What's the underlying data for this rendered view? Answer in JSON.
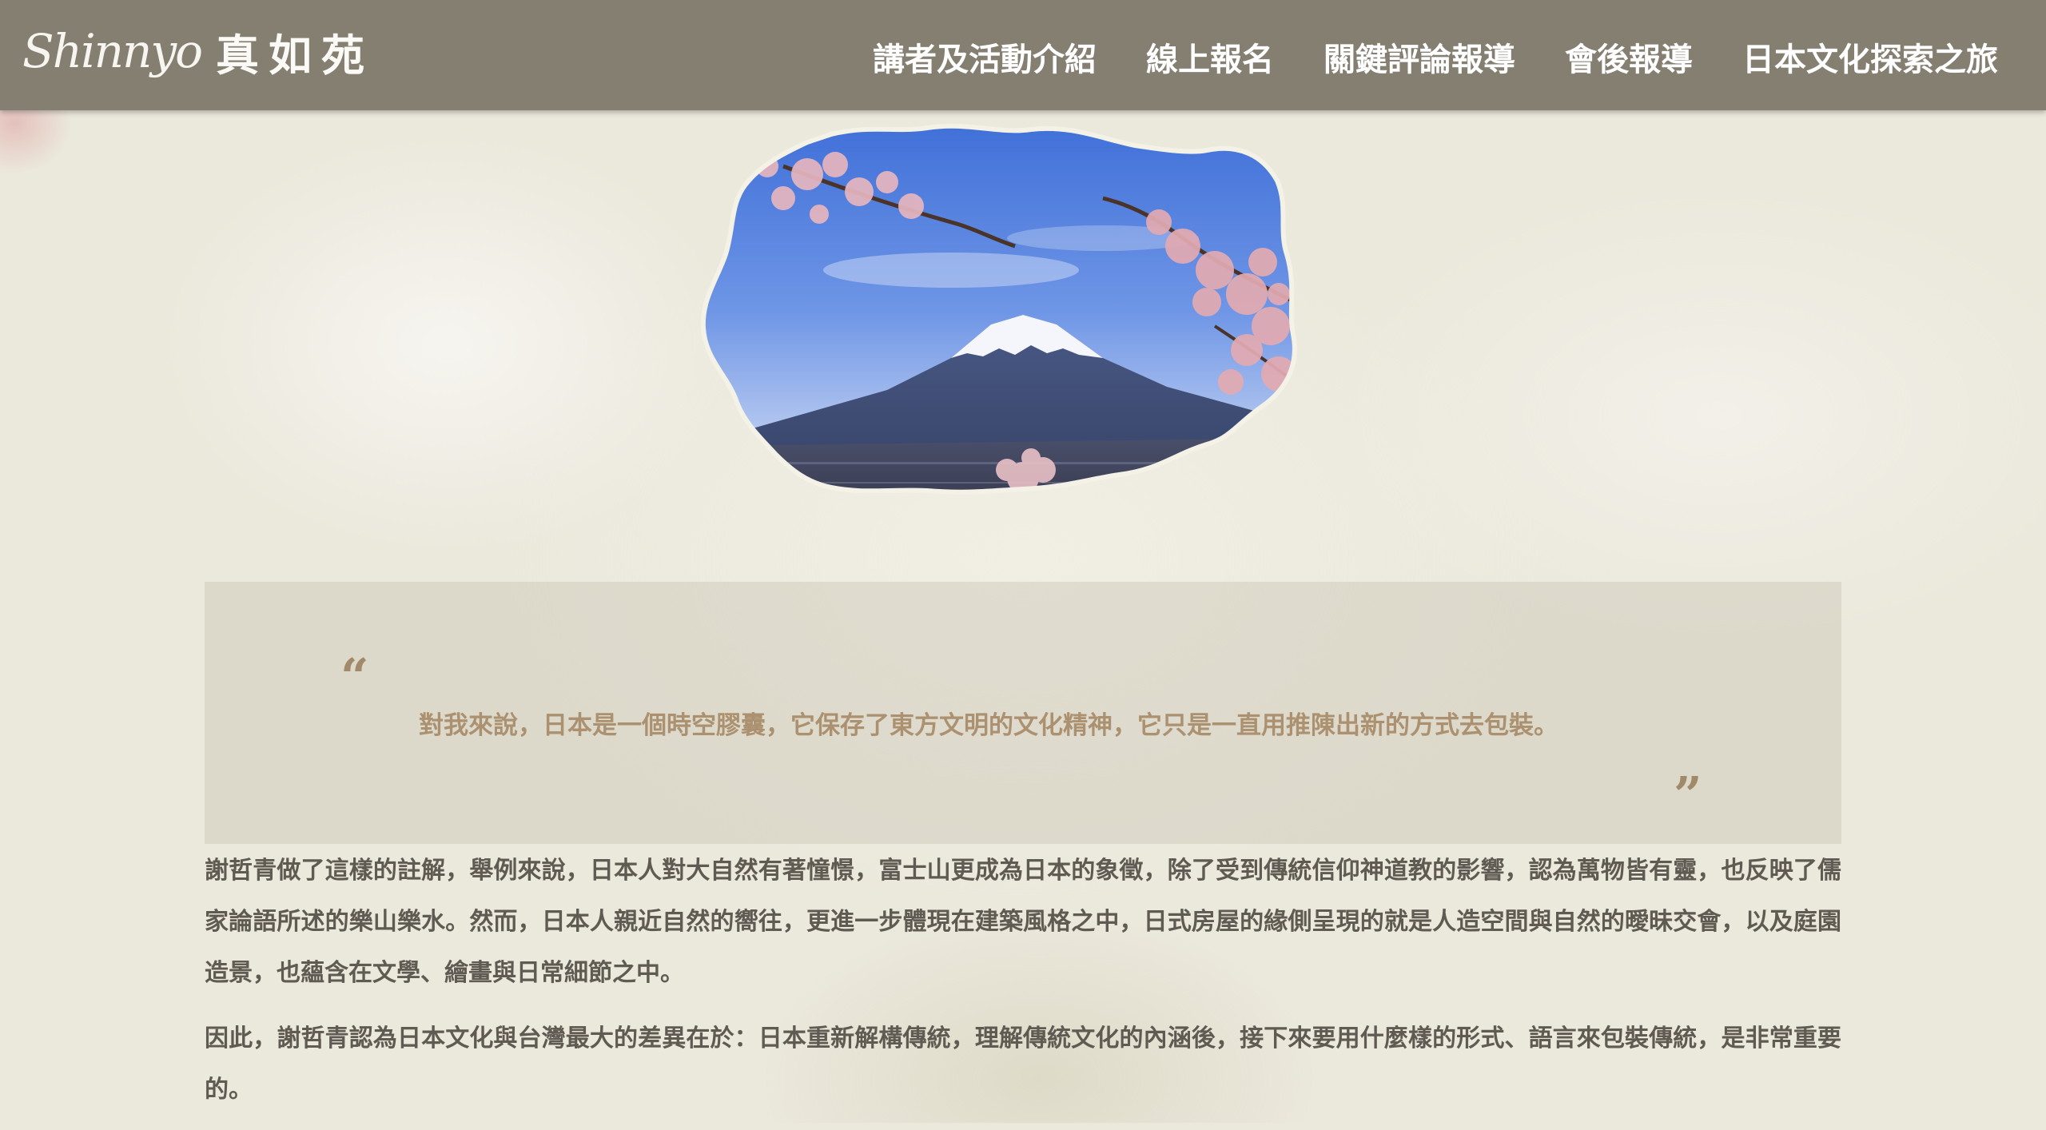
{
  "header": {
    "logo_script": "Shinnyo",
    "logo_kanji": "真如苑",
    "nav": [
      {
        "label": "講者及活動介紹"
      },
      {
        "label": "線上報名"
      },
      {
        "label": "關鍵評論報導"
      },
      {
        "label": "會後報導"
      },
      {
        "label": "日本文化探索之旅"
      }
    ]
  },
  "hero": {
    "image": "mount-fuji-cherry-blossom"
  },
  "quote": {
    "open_mark": "“",
    "text": "對我來說，日本是一個時空膠囊，它保存了東方文明的文化精神，它只是一直用推陳出新的方式去包裝。",
    "close_mark": "”"
  },
  "body": {
    "paragraphs": [
      "謝哲青做了這樣的註解，舉例來說，日本人對大自然有著憧憬，富士山更成為日本的象徵，除了受到傳統信仰神道教的影響，認為萬物皆有靈，也反映了儒家論語所述的樂山樂水。然而，日本人親近自然的嚮往，更進一步體現在建築風格之中，日式房屋的緣側呈現的就是人造空間與自然的曖昧交會，以及庭園造景，也蘊含在文學、繪畫與日常細節之中。",
      "因此，謝哲青認為日本文化與台灣最大的差異在於：日本重新解構傳統，理解傳統文化的內涵後，接下來要用什麼樣的形式、語言來包裝傳統，是非常重要的。"
    ]
  },
  "colors": {
    "header_bg": "#857f72",
    "page_bg": "#ebe8dc",
    "quote_text": "#ab9170",
    "body_text": "#5f5a52"
  }
}
